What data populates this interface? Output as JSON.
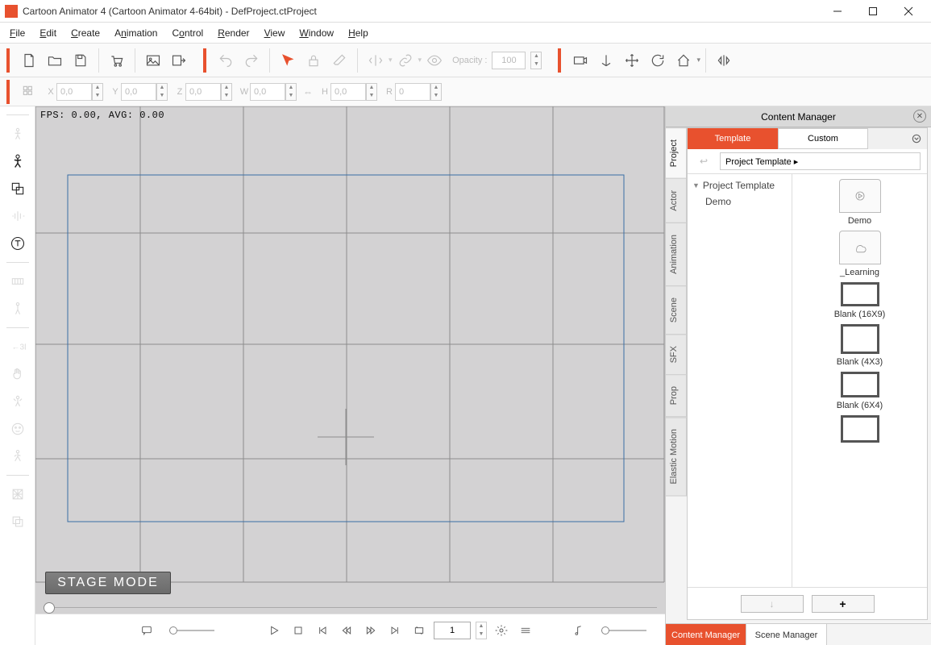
{
  "window": {
    "title": "Cartoon Animator 4  (Cartoon Animator 4-64bit) - DefProject.ctProject"
  },
  "menu": {
    "items": [
      "File",
      "Edit",
      "Create",
      "Animation",
      "Control",
      "Render",
      "View",
      "Window",
      "Help"
    ]
  },
  "toolbar": {
    "opacity_label": "Opacity :",
    "opacity_value": "100"
  },
  "coords": {
    "x": {
      "label": "X",
      "value": "0,0"
    },
    "y": {
      "label": "Y",
      "value": "0,0"
    },
    "z": {
      "label": "Z",
      "value": "0,0"
    },
    "w": {
      "label": "W",
      "value": "0,0"
    },
    "h": {
      "label": "H",
      "value": "0,0"
    },
    "r": {
      "label": "R",
      "value": "0"
    }
  },
  "stage": {
    "fps": "FPS: 0.00, AVG: 0.00",
    "mode_label": "STAGE MODE"
  },
  "playbar": {
    "frame": "1"
  },
  "content_manager": {
    "title": "Content Manager",
    "side_tabs": [
      "Project",
      "Actor",
      "Animation",
      "Scene",
      "SFX",
      "Prop",
      "Elastic Motion"
    ],
    "top_tabs": {
      "template": "Template",
      "custom": "Custom"
    },
    "breadcrumb": "Project Template ▸",
    "tree": {
      "root": "Project Template",
      "child": "Demo"
    },
    "items": [
      {
        "label": "Demo",
        "kind": "folder-play"
      },
      {
        "label": "_Learning",
        "kind": "folder-cloud"
      },
      {
        "label": "Blank (16X9)",
        "kind": "blank",
        "ratio": 1.6
      },
      {
        "label": "Blank (4X3)",
        "kind": "blank",
        "ratio": 1.3
      },
      {
        "label": "Blank (6X4)",
        "kind": "blank",
        "ratio": 1.5
      },
      {
        "label": "",
        "kind": "blank",
        "ratio": 1.4
      }
    ]
  },
  "bottom_tabs": {
    "content": "Content Manager",
    "scene": "Scene Manager"
  }
}
